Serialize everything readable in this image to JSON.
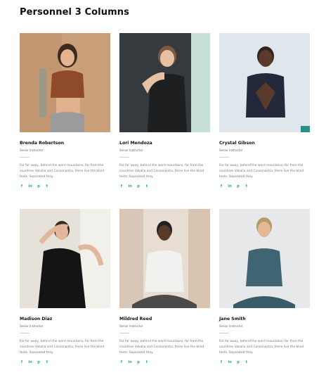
{
  "page": {
    "title": "Personnel 3 Columns"
  },
  "social_icons": [
    "facebook-icon",
    "linkedin-icon",
    "pinterest-icon",
    "twitter-icon"
  ],
  "social_glyphs": {
    "facebook": "f",
    "linkedin": "in",
    "pinterest": "p",
    "twitter": "t"
  },
  "personnel": [
    {
      "name": "Brenda Robertson",
      "role": "Senior Instructor",
      "bio": "Far far away, behind the word mountains, far from the countries Vokalia and Consonantia, there live the blind texts. Separated they."
    },
    {
      "name": "Lori Mendoza",
      "role": "Senior Instructor",
      "bio": "Far far away, behind the word mountains, far from the countries Vokalia and Consonantia, there live the blind texts. Separated they."
    },
    {
      "name": "Crystal Gibson",
      "role": "Senior Instructor",
      "bio": "Far far away, behind the word mountains, far from the countries Vokalia and Consonantia, there live the blind texts. Separated they."
    },
    {
      "name": "Madison Diaz",
      "role": "Senior Instructor",
      "bio": "Far far away, behind the word mountains, far from the countries Vokalia and Consonantia, there live the blind texts. Separated they."
    },
    {
      "name": "Mildred Reed",
      "role": "Senior Instructor",
      "bio": "Far far away, behind the word mountains, far from the countries Vokalia and Consonantia, there live the blind texts. Separated they."
    },
    {
      "name": "Jane Smith",
      "role": "Senior Instructor",
      "bio": "Far far away, behind the word mountains, far from the countries Vokalia and Consonantia, there live the blind texts. Separated they."
    }
  ],
  "colors": {
    "accent": "#2f9f8f",
    "text": "#111111",
    "muted": "#777777"
  }
}
